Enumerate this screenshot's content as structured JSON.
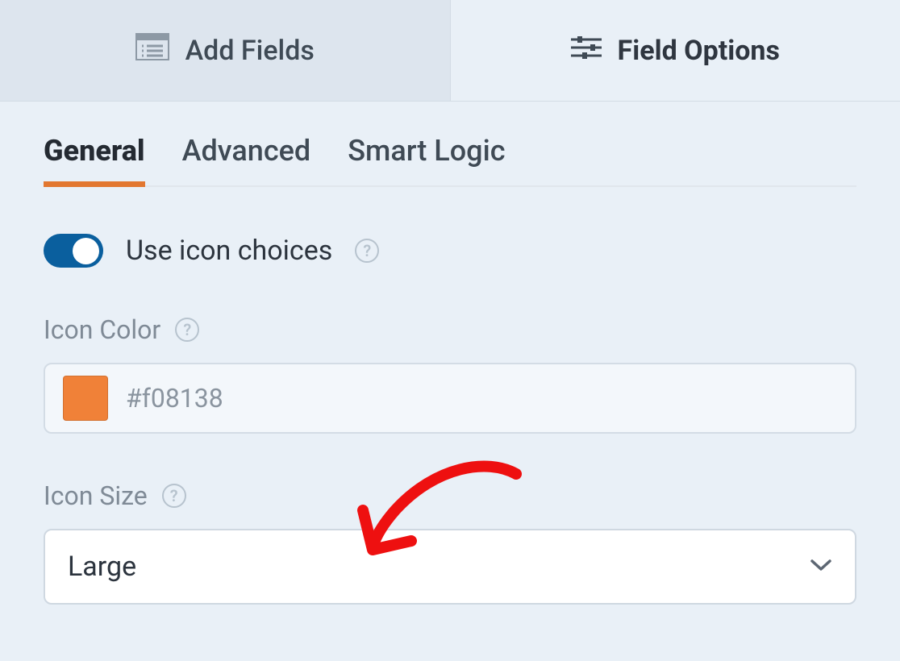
{
  "topTabs": {
    "addFields": "Add Fields",
    "fieldOptions": "Field Options"
  },
  "subTabs": {
    "general": "General",
    "advanced": "Advanced",
    "smartLogic": "Smart Logic"
  },
  "toggle": {
    "label": "Use icon choices"
  },
  "iconColor": {
    "label": "Icon Color",
    "value": "#f08138"
  },
  "iconSize": {
    "label": "Icon Size",
    "value": "Large"
  }
}
